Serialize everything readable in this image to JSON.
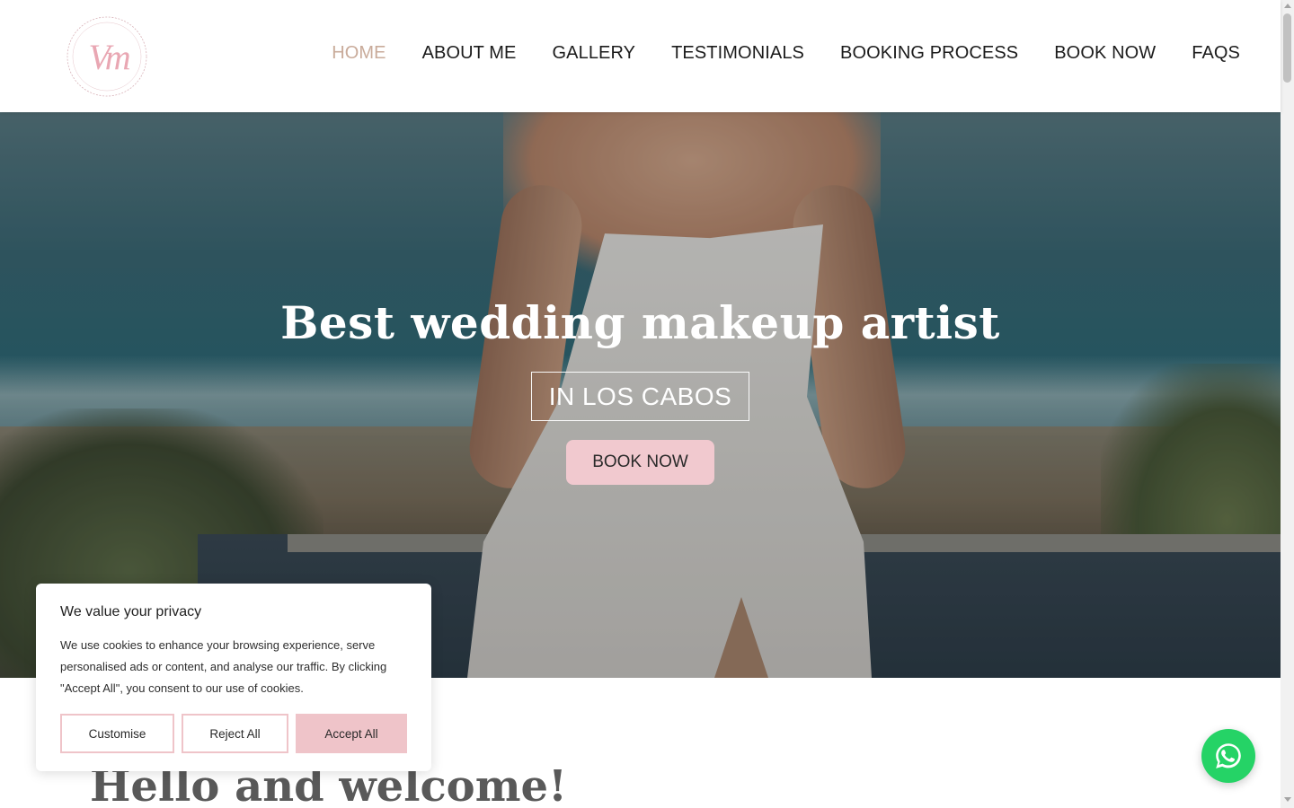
{
  "brand": {
    "logo_initials": "Vm",
    "logo_ring_text": "MAKE UP AND MAKEUP BY DANIELLA LEON",
    "logo_color": "#e9a7b3"
  },
  "nav": {
    "items": [
      {
        "label": "HOME",
        "active": true
      },
      {
        "label": "ABOUT ME",
        "active": false
      },
      {
        "label": "GALLERY",
        "active": false
      },
      {
        "label": "TESTIMONIALS",
        "active": false
      },
      {
        "label": "BOOKING PROCESS",
        "active": false
      },
      {
        "label": "BOOK NOW",
        "active": false
      },
      {
        "label": "FAQS",
        "active": false
      }
    ],
    "active_color": "#c9ab9a"
  },
  "hero": {
    "title": "Best wedding makeup artist",
    "subtitle": "IN LOS CABOS",
    "cta_label": "BOOK NOW",
    "cta_color": "#f1c9cf"
  },
  "welcome": {
    "heading": "Hello and welcome!"
  },
  "cookie_banner": {
    "title": "We value your privacy",
    "text": "We use cookies to enhance your browsing experience, serve personalised ads or content, and analyse our traffic. By clicking \"Accept All\", you consent to our use of cookies.",
    "buttons": {
      "customise": "Customise",
      "reject": "Reject All",
      "accept": "Accept All"
    },
    "accent_color": "#efc4c9"
  },
  "whatsapp": {
    "icon": "whatsapp-icon",
    "color": "#25d366"
  }
}
